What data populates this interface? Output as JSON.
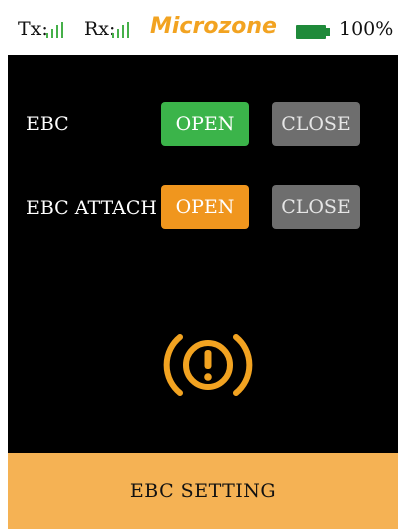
{
  "status_bar": {
    "tx_label": "Tx:",
    "rx_label": "Rx:",
    "brand": "Microzone",
    "battery_percent": "100%"
  },
  "rows": [
    {
      "label": "EBC",
      "open_label": "OPEN",
      "close_label": "CLOSE",
      "open_selected": true
    },
    {
      "label": "EBC ATTACH",
      "open_label": "OPEN",
      "close_label": "CLOSE",
      "open_selected": true
    }
  ],
  "icons": {
    "warning": "brake-warning-icon",
    "signal": "signal-bars-icon",
    "battery": "battery-icon"
  },
  "colors": {
    "brand": "#f2a321",
    "open_active_row1": "#3bb44a",
    "open_active_row2": "#f0961e",
    "inactive": "#6e6e6e",
    "footer": "#f5b254",
    "battery": "#1f8a3a"
  },
  "footer": {
    "title": "EBC SETTING"
  }
}
